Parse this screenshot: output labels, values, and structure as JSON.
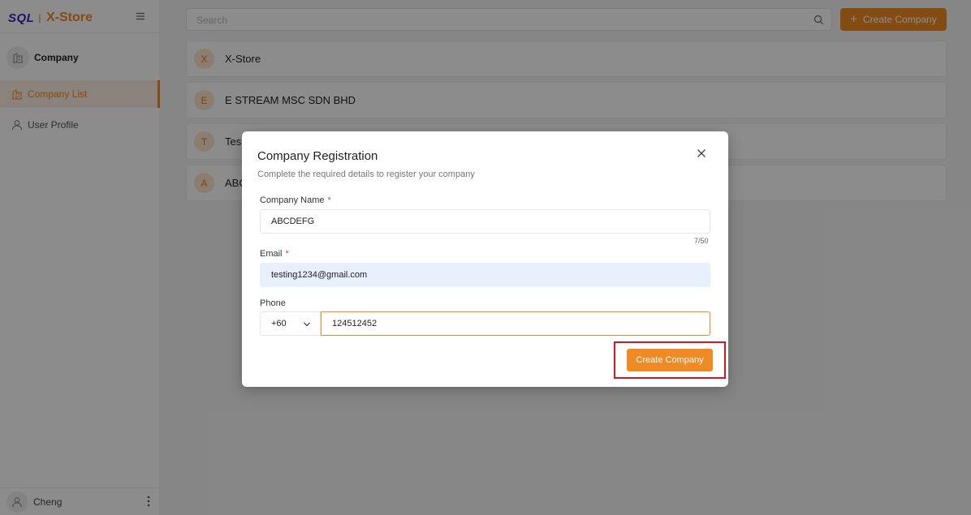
{
  "brand": {
    "sql": "SQL",
    "separator": "|",
    "name": "X-Store"
  },
  "sidebar": {
    "section_title": "Company",
    "items": [
      {
        "label": "Company List",
        "icon": "building-icon",
        "active": true
      },
      {
        "label": "User Profile",
        "icon": "user-icon",
        "active": false
      }
    ],
    "user": {
      "name": "Cheng"
    }
  },
  "header": {
    "search_placeholder": "Search",
    "create_button": "Create Company"
  },
  "companies": [
    {
      "initial": "X",
      "name": "X-Store"
    },
    {
      "initial": "E",
      "name": "E STREAM MSC SDN BHD"
    },
    {
      "initial": "T",
      "name": "Tes"
    },
    {
      "initial": "A",
      "name": "ABC"
    }
  ],
  "modal": {
    "title": "Company Registration",
    "subtitle": "Complete the required details to register your company",
    "company_name_label": "Company Name",
    "company_name_value": "ABCDEFG",
    "company_name_counter": "7/50",
    "email_label": "Email",
    "email_value": "testing1234@gmail.com",
    "phone_label": "Phone",
    "country_code": "+60",
    "phone_value": "124512452",
    "required_mark": "*",
    "submit_label": "Create Company"
  },
  "colors": {
    "accent": "#f08a24",
    "highlight": "#d4161f",
    "brand_sql": "#3d1fb7"
  }
}
